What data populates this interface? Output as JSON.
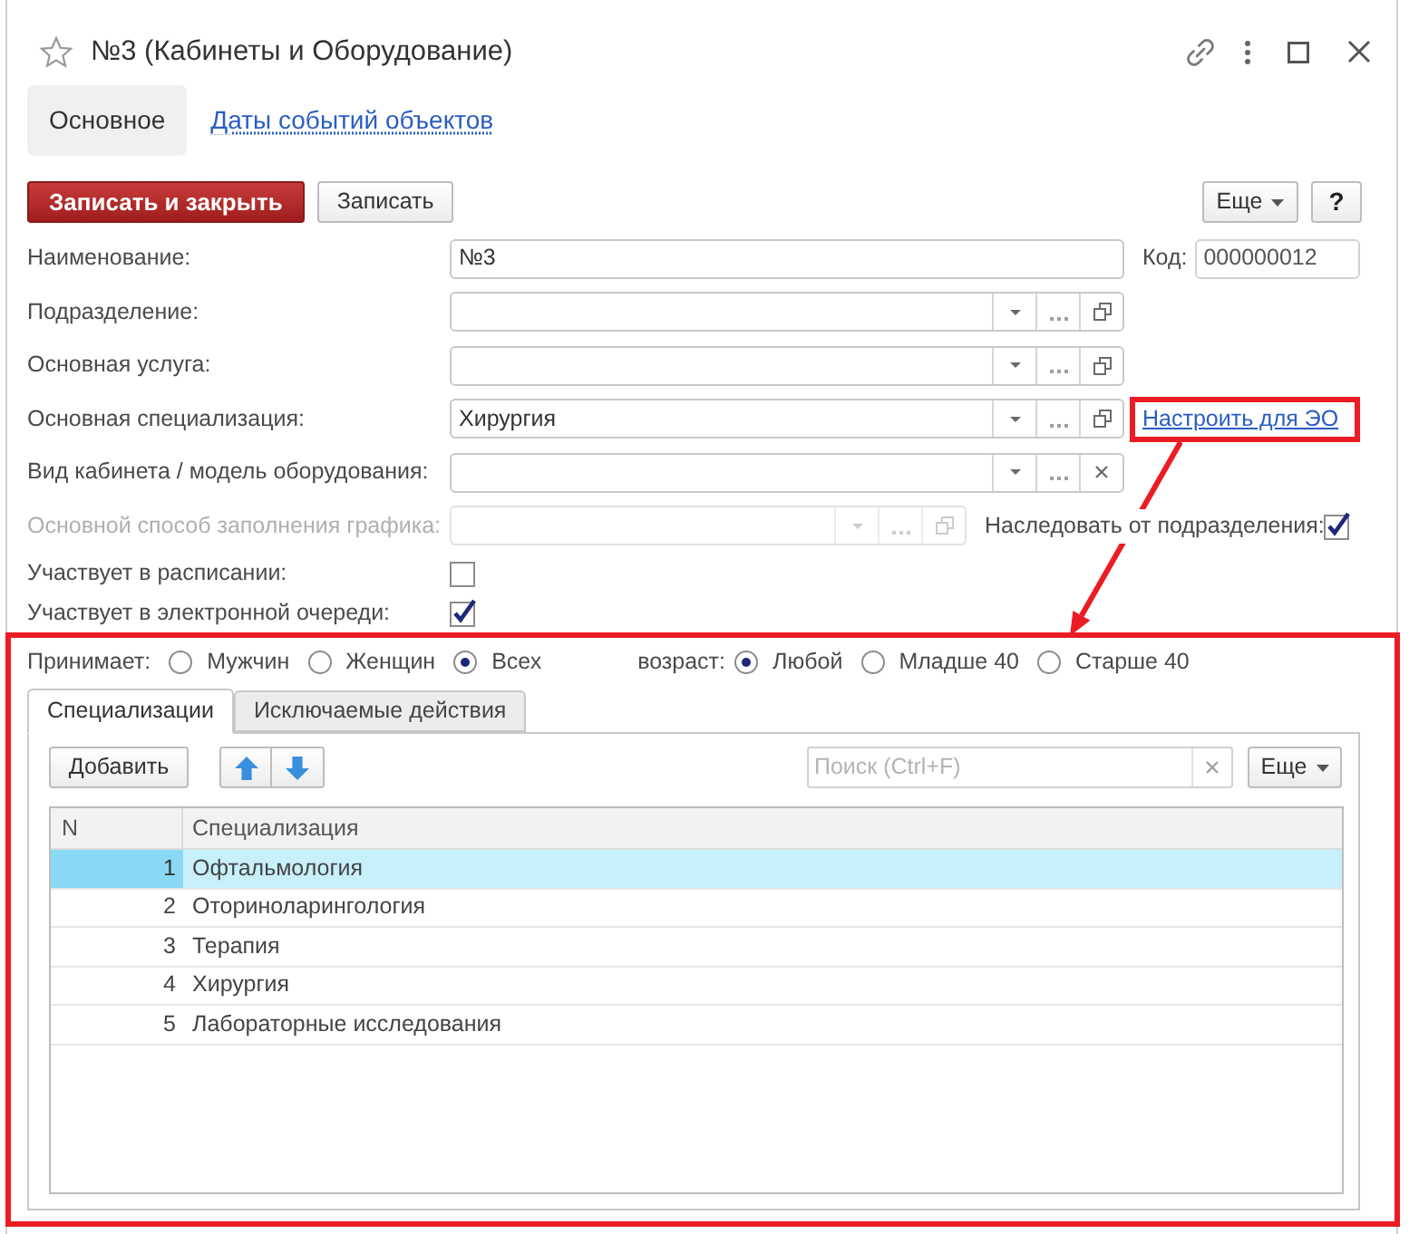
{
  "window": {
    "title": "№3 (Кабинеты и Оборудование)",
    "favorite": false
  },
  "tabs": [
    {
      "label": "Основное",
      "selected": true
    },
    {
      "label": "Даты событий объектов",
      "selected": false
    }
  ],
  "toolbar": {
    "buttons": [
      {
        "label": "Записать и закрыть",
        "kind": "primary"
      },
      {
        "label": "Записать",
        "kind": "default"
      }
    ],
    "more": "Еще",
    "help": "?"
  },
  "fields": [
    {
      "label": "Наименование:",
      "kind": "text",
      "value": "№3",
      "disabled": false,
      "side": {
        "kind": "code",
        "label": "Код:",
        "value": "000000012"
      }
    },
    {
      "label": "Подразделение:",
      "kind": "select",
      "disabled": false,
      "buttons": [
        {
          "kind": "dropdown"
        },
        {
          "kind": "choose"
        },
        {
          "kind": "open"
        }
      ]
    },
    {
      "label": "Основная услуга:",
      "kind": "select",
      "disabled": false,
      "buttons": [
        {
          "kind": "dropdown"
        },
        {
          "kind": "choose"
        },
        {
          "kind": "open"
        }
      ]
    },
    {
      "label": "Основная специализация:",
      "kind": "select",
      "value": "Хирургия",
      "disabled": false,
      "buttons": [
        {
          "kind": "dropdown"
        },
        {
          "kind": "choose"
        },
        {
          "kind": "open"
        }
      ],
      "side": {
        "kind": "link",
        "label": "Настроить для ЭО",
        "highlighted": true
      }
    },
    {
      "label": "Вид кабинета / модель оборудования:",
      "kind": "select",
      "disabled": false,
      "buttons": [
        {
          "kind": "dropdown"
        },
        {
          "kind": "choose"
        },
        {
          "kind": "clear"
        }
      ]
    },
    {
      "label": "Основной способ заполнения графика:",
      "kind": "select",
      "disabled": true,
      "buttons": [
        {
          "kind": "dropdown"
        },
        {
          "kind": "choose"
        },
        {
          "kind": "open"
        }
      ],
      "side": {
        "kind": "checkbox",
        "label": "Наследовать от подразделения:",
        "checked": true
      }
    },
    {
      "label": "Участвует в расписании:",
      "kind": "checkbox",
      "checked": false,
      "disabled": false
    },
    {
      "label": "Участвует в электронной очереди:",
      "kind": "checkbox",
      "checked": true,
      "disabled": false
    }
  ],
  "details": {
    "highlighted": true,
    "filters": [
      {
        "label": "Принимает:",
        "options": [
          {
            "label": "Мужчин",
            "selected": false
          },
          {
            "label": "Женщин",
            "selected": false
          },
          {
            "label": "Всех",
            "selected": true
          }
        ]
      },
      {
        "label": "возраст:",
        "options": [
          {
            "label": "Любой",
            "selected": true
          },
          {
            "label": "Младше 40",
            "selected": false
          },
          {
            "label": "Старше 40",
            "selected": false
          }
        ]
      }
    ],
    "tabs": [
      {
        "label": "Специализации",
        "selected": true
      },
      {
        "label": "Исключаемые действия",
        "selected": false
      }
    ],
    "toolbar": {
      "add": "Добавить",
      "search": {
        "placeholder": "Поиск (Ctrl+F)"
      },
      "more": "Еще"
    },
    "table": {
      "columns": [
        "N",
        "Специализация"
      ],
      "rows": [
        {
          "n": "1",
          "name": "Офтальмология",
          "selected": true
        },
        {
          "n": "2",
          "name": "Оториноларингология",
          "selected": false
        },
        {
          "n": "3",
          "name": "Терапия",
          "selected": false
        },
        {
          "n": "4",
          "name": "Хирургия",
          "selected": false
        },
        {
          "n": "5",
          "name": "Лабораторные исследования",
          "selected": false
        }
      ]
    }
  }
}
